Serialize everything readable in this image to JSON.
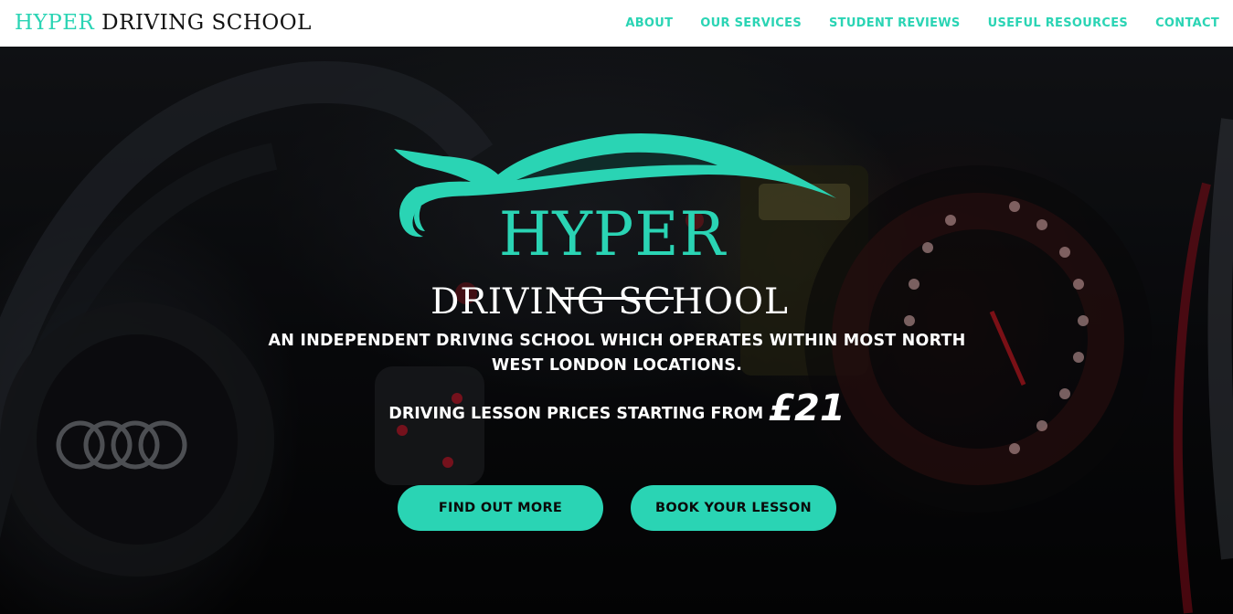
{
  "header": {
    "brand_primary": "HYPER",
    "brand_secondary": "DRIVING SCHOOL"
  },
  "nav": {
    "items": [
      {
        "label": "ABOUT"
      },
      {
        "label": "OUR SERVICES"
      },
      {
        "label": "STUDENT REVIEWS"
      },
      {
        "label": "USEFUL RESOURCES"
      },
      {
        "label": "CONTACT"
      }
    ]
  },
  "hero": {
    "logo_word": "HYPER",
    "logo_subtitle": "DRIVING SCHOOL",
    "tagline": "AN INDEPENDENT DRIVING SCHOOL WHICH OPERATES WITHIN MOST NORTH WEST LONDON LOCATIONS.",
    "price_prefix": "DRIVING LESSON PRICES STARTING FROM",
    "price_amount": "£21",
    "buttons": {
      "find_out_more": "FIND OUT MORE",
      "book_lesson": "BOOK YOUR LESSON"
    }
  },
  "colors": {
    "accent": "#2ad4b4",
    "text_dark": "#111111",
    "hero_text": "#ffffff"
  },
  "icons": {
    "logo_mark": "car-silhouette-icon"
  }
}
